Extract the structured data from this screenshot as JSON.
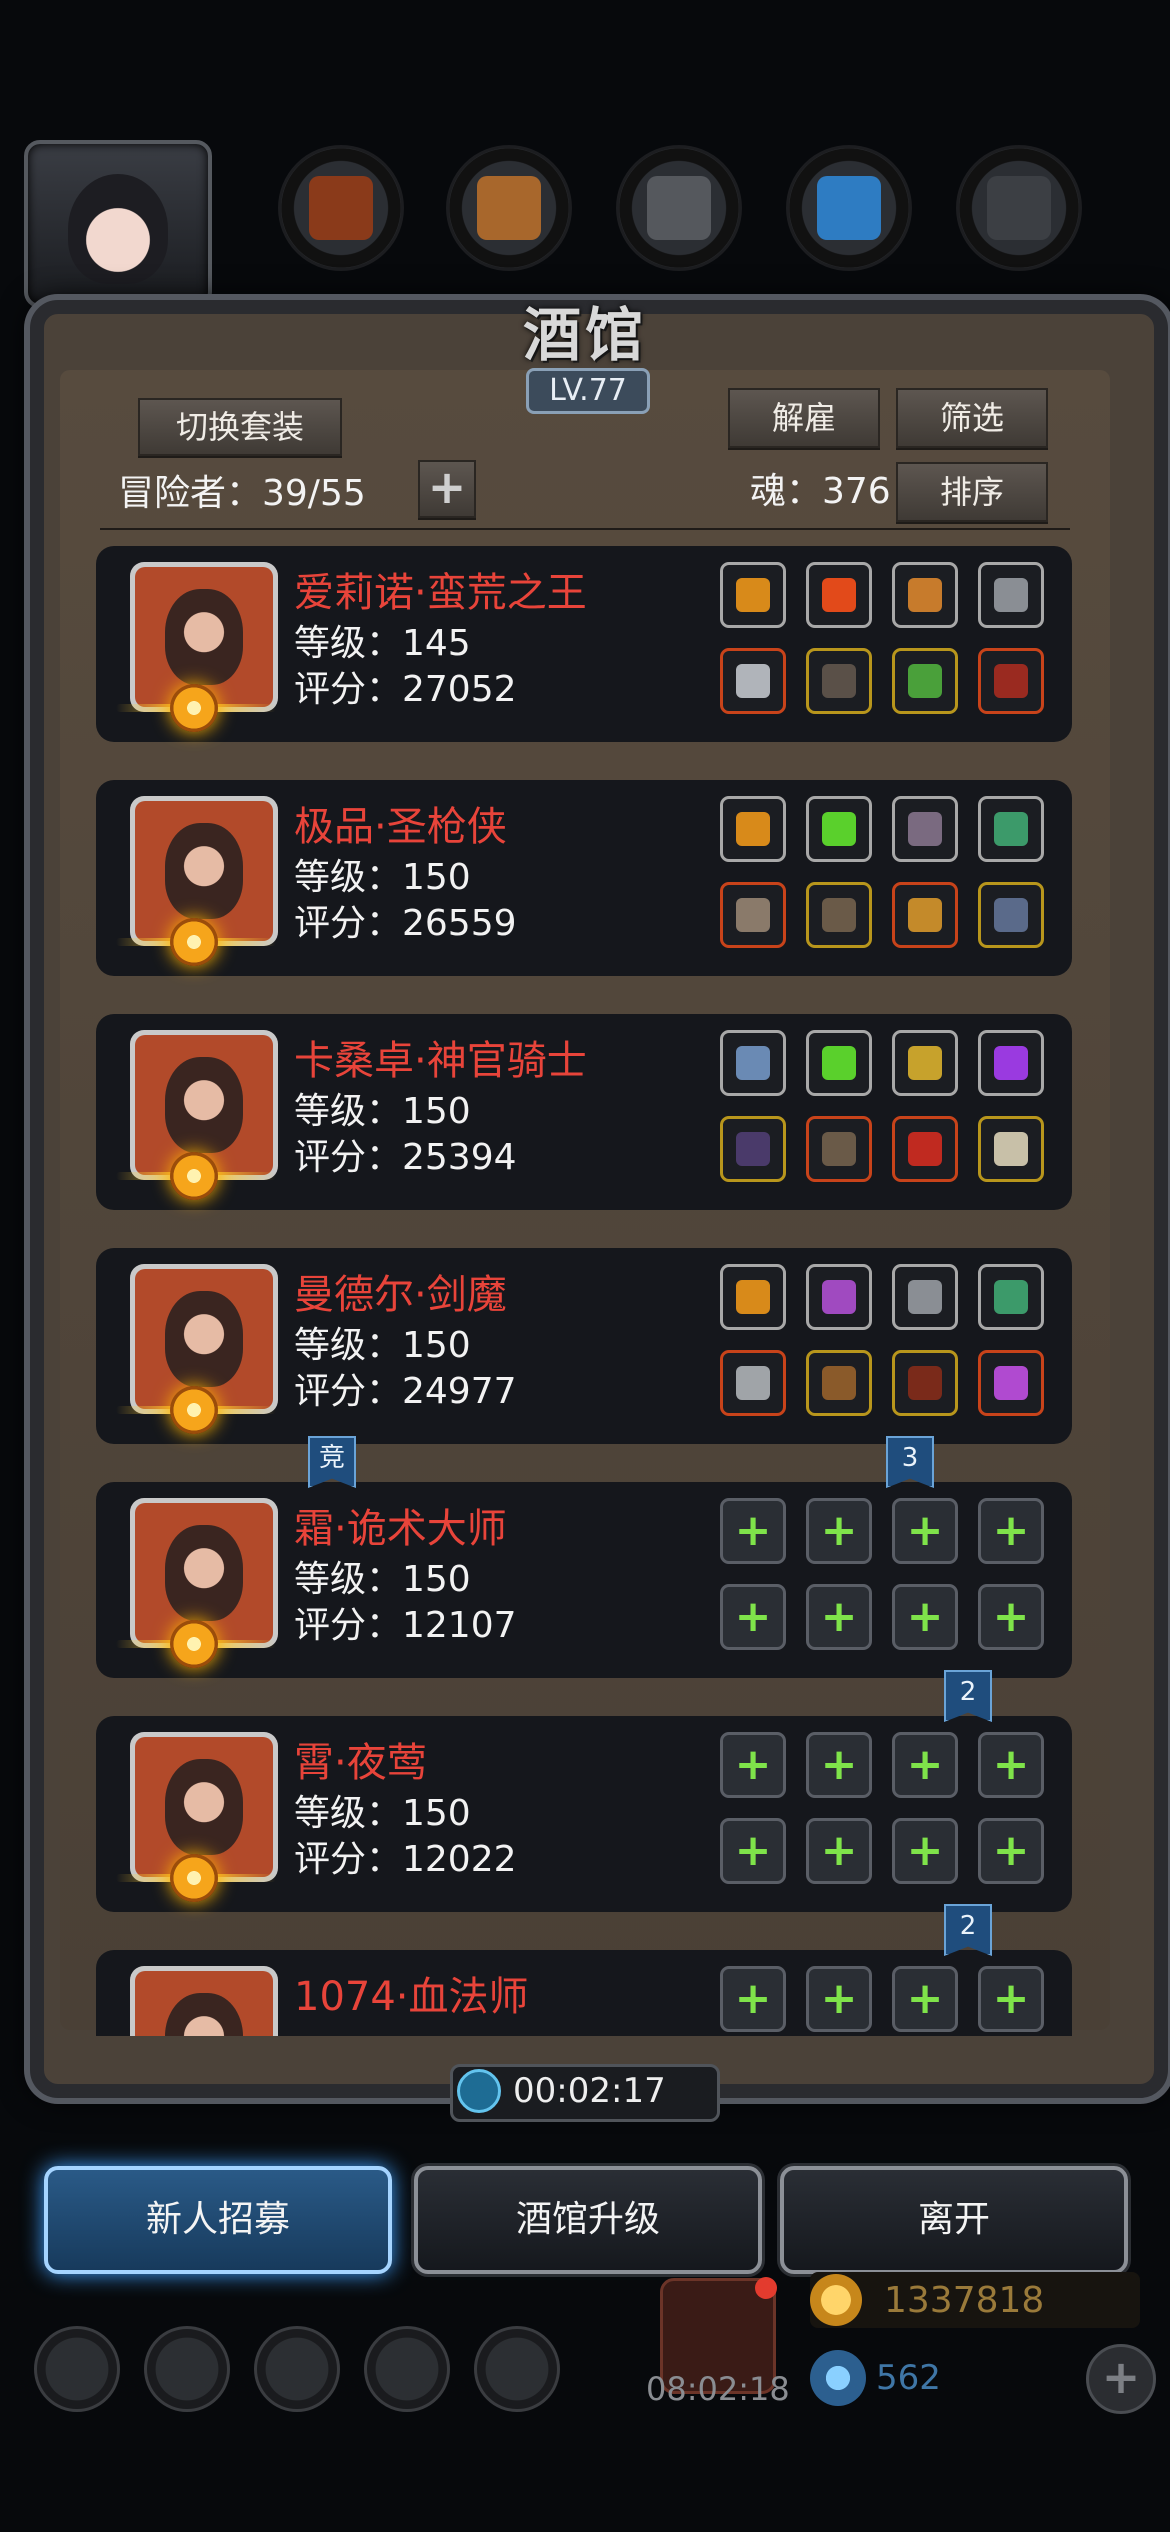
{
  "tavern": {
    "title": "酒馆",
    "level": "LV.77",
    "switch_outfit": "切换套装",
    "adventurers_label": "冒险者：39/55",
    "add": "+",
    "dismiss": "解雇",
    "filter": "筛选",
    "soul_label": "魂：376",
    "sort": "排序"
  },
  "heroes": [
    {
      "name": "爱莉诺·蛮荒之王",
      "level": "等级：145",
      "score": "评分：27052",
      "slots": [
        {
          "empty": false,
          "rarity": "silver",
          "icon": "crown-icon",
          "color": "#d88a1a"
        },
        {
          "empty": false,
          "rarity": "silver",
          "icon": "fire-orb-icon",
          "color": "#e24a1a"
        },
        {
          "empty": false,
          "rarity": "silver",
          "icon": "lantern-icon",
          "color": "#c77b2c"
        },
        {
          "empty": false,
          "rarity": "silver",
          "icon": "mask-icon",
          "color": "#8a8e94"
        },
        {
          "empty": false,
          "rarity": "red",
          "icon": "axe-icon",
          "color": "#b0b4ba"
        },
        {
          "empty": false,
          "rarity": "gold",
          "icon": "armor-icon",
          "color": "#5a5048"
        },
        {
          "empty": false,
          "rarity": "gold",
          "icon": "ring-icon",
          "color": "#4aa03a"
        },
        {
          "empty": false,
          "rarity": "red",
          "icon": "demon-gauntlet-icon",
          "color": "#9a2a20"
        }
      ]
    },
    {
      "name": "极品·圣枪侠",
      "level": "等级：150",
      "score": "评分：26559",
      "slots": [
        {
          "empty": false,
          "rarity": "silver",
          "icon": "crown-icon",
          "color": "#d88a1a"
        },
        {
          "empty": false,
          "rarity": "silver",
          "icon": "green-crystal-icon",
          "color": "#5ad02c"
        },
        {
          "empty": false,
          "rarity": "silver",
          "icon": "feather-icon",
          "color": "#7a6a80"
        },
        {
          "empty": false,
          "rarity": "silver",
          "icon": "green-lantern-icon",
          "color": "#3c9a6a"
        },
        {
          "empty": false,
          "rarity": "red",
          "icon": "staff-icon",
          "color": "#8a7a6a"
        },
        {
          "empty": false,
          "rarity": "gold",
          "icon": "armor-icon",
          "color": "#6a5a48"
        },
        {
          "empty": false,
          "rarity": "red",
          "icon": "horn-helm-icon",
          "color": "#c48a2a"
        },
        {
          "empty": false,
          "rarity": "gold",
          "icon": "spear-icon",
          "color": "#5a6a8a"
        }
      ]
    },
    {
      "name": "卡桑卓·神官骑士",
      "level": "等级：150",
      "score": "评分：25394",
      "slots": [
        {
          "empty": false,
          "rarity": "silver",
          "icon": "wing-icon",
          "color": "#6a8ab4"
        },
        {
          "empty": false,
          "rarity": "silver",
          "icon": "green-crystal-icon",
          "color": "#5ad02c"
        },
        {
          "empty": false,
          "rarity": "silver",
          "icon": "lantern-icon",
          "color": "#c7a22c"
        },
        {
          "empty": false,
          "rarity": "silver",
          "icon": "purple-gem-icon",
          "color": "#9a3ae0"
        },
        {
          "empty": false,
          "rarity": "gold",
          "icon": "dark-staff-icon",
          "color": "#4a3a6a"
        },
        {
          "empty": false,
          "rarity": "red",
          "icon": "armor-icon",
          "color": "#6a5a48"
        },
        {
          "empty": false,
          "rarity": "red",
          "icon": "demon-gauntlet-icon",
          "color": "#c02a20"
        },
        {
          "empty": false,
          "rarity": "gold",
          "icon": "amulet-icon",
          "color": "#c8c0a8"
        }
      ]
    },
    {
      "name": "曼德尔·剑魔",
      "level": "等级：150",
      "score": "评分：24977",
      "slots": [
        {
          "empty": false,
          "rarity": "silver",
          "icon": "crown-icon",
          "color": "#d88a1a"
        },
        {
          "empty": false,
          "rarity": "silver",
          "icon": "purple-orb-icon",
          "color": "#a04ac0"
        },
        {
          "empty": false,
          "rarity": "silver",
          "icon": "mask-icon",
          "color": "#8a8e94"
        },
        {
          "empty": false,
          "rarity": "silver",
          "icon": "green-lantern-icon",
          "color": "#3c9a6a"
        },
        {
          "empty": false,
          "rarity": "red",
          "icon": "sword-icon",
          "color": "#a0a4a8"
        },
        {
          "empty": false,
          "rarity": "gold",
          "icon": "armor-icon",
          "color": "#8a5a2a"
        },
        {
          "empty": false,
          "rarity": "gold",
          "icon": "bracer-icon",
          "color": "#7a2a1a"
        },
        {
          "empty": false,
          "rarity": "red",
          "icon": "purple-gauntlet-icon",
          "color": "#b04ad0"
        }
      ]
    },
    {
      "name": "霜·诡术大师",
      "level": "等级：150",
      "score": "评分：12107",
      "slots": [
        {
          "empty": true
        },
        {
          "empty": true
        },
        {
          "empty": true
        },
        {
          "empty": true
        },
        {
          "empty": true
        },
        {
          "empty": true
        },
        {
          "empty": true
        },
        {
          "empty": true
        }
      ]
    },
    {
      "name": "霄·夜莺",
      "level": "等级：150",
      "score": "评分：12022",
      "slots": [
        {
          "empty": true
        },
        {
          "empty": true
        },
        {
          "empty": true
        },
        {
          "empty": true
        },
        {
          "empty": true
        },
        {
          "empty": true
        },
        {
          "empty": true
        },
        {
          "empty": true
        }
      ]
    },
    {
      "name": "1074·血法师",
      "level": "",
      "score": "",
      "slots": [
        {
          "empty": true
        },
        {
          "empty": true
        },
        {
          "empty": true
        },
        {
          "empty": true
        },
        {
          "empty": true
        },
        {
          "empty": true
        },
        {
          "empty": true
        },
        {
          "empty": true
        }
      ]
    }
  ],
  "tags": {
    "arena": "竞",
    "count_a": "3",
    "count_b": "2",
    "count_c": "2"
  },
  "timer": "00:02:17",
  "buttons": {
    "recruit": "新人招募",
    "upgrade": "酒馆升级",
    "leave": "离开"
  },
  "footer": {
    "gift_timer": "08:02:18",
    "gold": "1337818",
    "gems": "562",
    "add": "+"
  }
}
